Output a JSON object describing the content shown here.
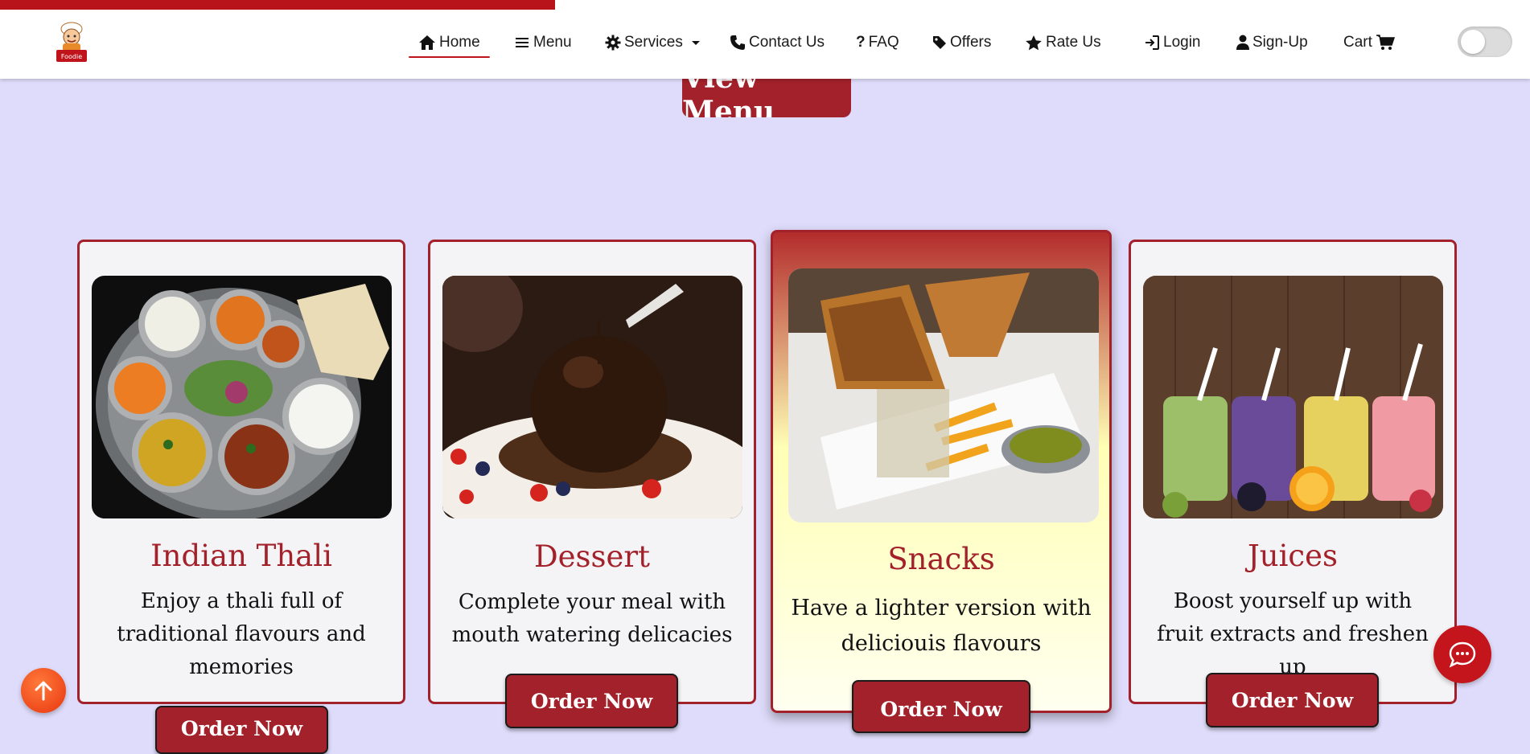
{
  "progress": {
    "fraction": 0.363,
    "color": "#b8131a"
  },
  "logo": {
    "text": "Foodie"
  },
  "nav": {
    "home": "Home",
    "menu": "Menu",
    "services": "Services",
    "contact": "Contact Us",
    "faq": "FAQ",
    "offers": "Offers",
    "rate": "Rate Us",
    "login": "Login",
    "signup": "Sign-Up",
    "cart": "Cart"
  },
  "hero": {
    "view_menu": "View Menu"
  },
  "cards": [
    {
      "title": "Indian Thali",
      "description": "Enjoy a thali full of traditional flavours and memories",
      "button": "Order Now"
    },
    {
      "title": "Dessert",
      "description": "Complete your meal with mouth watering delicacies",
      "button": "Order Now"
    },
    {
      "title": "Snacks",
      "description": "Have a lighter version with deliciouis flavours",
      "button": "Order Now"
    },
    {
      "title": "Juices",
      "description": "Boost yourself up with fruit extracts and freshen up",
      "button": "Order Now"
    }
  ],
  "colors": {
    "accent": "#a3212a",
    "page_background": "#dedcfa",
    "card_background": "#f4f3f5",
    "scroll_top": "#f0461e",
    "chat": "#c4151d"
  },
  "icons": {
    "home": "home-icon",
    "menu": "bars-icon",
    "services": "gear-icon",
    "contact": "phone-icon",
    "faq": "question-icon",
    "offers": "tag-icon",
    "rate": "star-icon",
    "login": "login-icon",
    "signup": "user-icon",
    "cart": "cart-icon",
    "scroll_top": "arrow-up-icon",
    "chat": "chat-icon"
  }
}
